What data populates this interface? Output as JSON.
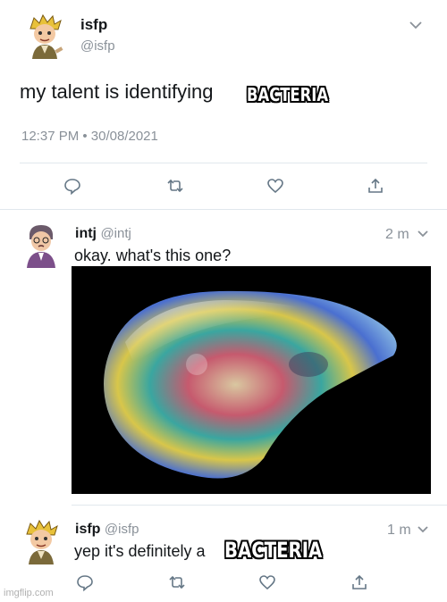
{
  "tweet1": {
    "name": "isfp",
    "handle": "@isfp",
    "text": "my talent is identifying",
    "overlay": "BACTERIA",
    "timestamp": "12:37 PM • 30/08/2021",
    "avatar_icon": "cartoon-boy-avatar"
  },
  "reply1": {
    "name": "intj",
    "handle": "@intj",
    "time": "2 m",
    "text": "okay. what's this one?",
    "avatar_icon": "cartoon-man-avatar",
    "image_icon": "iridescent-bubble-image"
  },
  "reply2": {
    "name": "isfp",
    "handle": "@isfp",
    "time": "1 m",
    "text": "yep it's definitely a",
    "overlay": "BACTERIA",
    "avatar_icon": "cartoon-boy-avatar"
  },
  "actions": [
    "reply-icon",
    "retweet-icon",
    "like-icon",
    "share-icon"
  ],
  "watermark": "imgflip.com",
  "colors": {
    "icon": "#657786",
    "divider": "#e1e8ed",
    "muted": "#8a9199"
  }
}
